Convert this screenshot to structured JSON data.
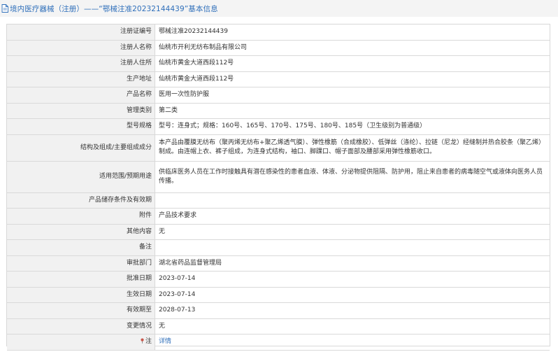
{
  "header": {
    "title": "境内医疗器械（注册）——“鄂械注准20232144439”基本信息"
  },
  "fields": [
    {
      "label": "注册证编号",
      "value": "鄂械注准20232144439"
    },
    {
      "label": "注册人名称",
      "value": "仙桃市开利无纺布制品有限公司"
    },
    {
      "label": "注册人住所",
      "value": "仙桃市黄金大道西段112号"
    },
    {
      "label": "生产地址",
      "value": "仙桃市黄金大道西段112号"
    },
    {
      "label": "产品名称",
      "value": "医用一次性防护服"
    },
    {
      "label": "管理类别",
      "value": "第二类"
    },
    {
      "label": "型号规格",
      "value": "型号：连身式；规格：160号、165号、170号、175号、180号、185号（卫生级别为普通级）"
    },
    {
      "label": "结构及组成/主要组成成分",
      "value": "本产品由覆膜无纺布（聚丙烯无纺布+聚乙烯透气膜）、弹性橡筋（合成橡胶）、低弹丝（涤纶）、拉链（尼龙）经缝制并热合胶条（聚乙烯）制成。由连帽上衣、裤子组成，为连身式结构，袖口、脚踝口、帽子面部及腰部采用弹性橡筋收口。"
    },
    {
      "label": "适用范围/预期用途",
      "value": "供临床医务人员在工作时接触具有潜在感染性的患者血液、体液、分泌物提供阻隔、防护用，阻止来自患者的病毒随空气或液体向医务人员传播。"
    },
    {
      "label": "产品储存条件及有效期",
      "value": ""
    },
    {
      "label": "附件",
      "value": "产品技术要求"
    },
    {
      "label": "其他内容",
      "value": "无"
    },
    {
      "label": "备注",
      "value": ""
    },
    {
      "label": "审批部门",
      "value": "湖北省药品监督管理局"
    },
    {
      "label": "批准日期",
      "value": "2023-07-14"
    },
    {
      "label": "生效日期",
      "value": "2023-07-14"
    },
    {
      "label": "有效期至",
      "value": "2028-07-13"
    },
    {
      "label": "变更情况",
      "value": "无"
    }
  ],
  "note": {
    "label": "注",
    "link_text": "详情"
  },
  "colors": {
    "accent": "#2f6fba",
    "label_bg": "#f1f1f1",
    "header_bg": "#f4f4f4",
    "border": "#d9d9d9"
  }
}
